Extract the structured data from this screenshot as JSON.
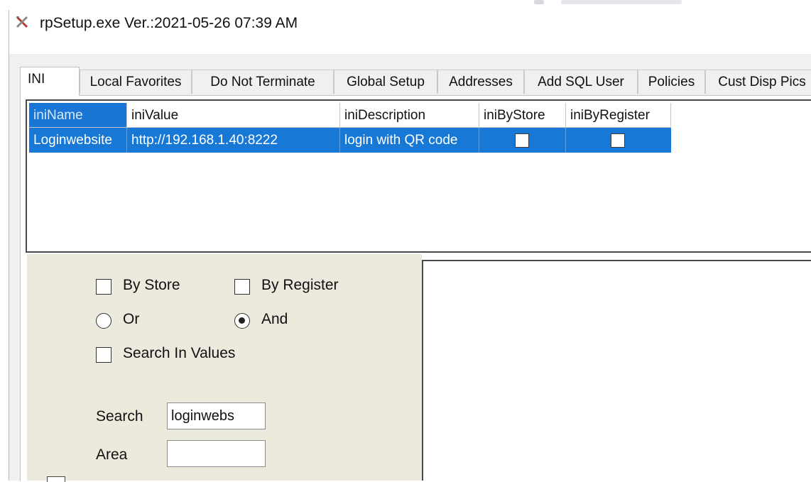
{
  "window": {
    "title": "rpSetup.exe Ver.:2021-05-26 07:39 AM",
    "app_icon": "x-tools-icon"
  },
  "tabs": [
    {
      "label": "INI",
      "active": true
    },
    {
      "label": "Local Favorites",
      "active": false
    },
    {
      "label": "Do Not Terminate",
      "active": false
    },
    {
      "label": "Global Setup",
      "active": false
    },
    {
      "label": "Addresses",
      "active": false
    },
    {
      "label": "Add SQL User",
      "active": false
    },
    {
      "label": "Policies",
      "active": false
    },
    {
      "label": "Cust Disp Pics",
      "active": false
    }
  ],
  "grid": {
    "columns": [
      "iniName",
      "iniValue",
      "iniDescription",
      "iniByStore",
      "iniByRegister"
    ],
    "rows": [
      {
        "iniName": "Loginwebsite",
        "iniValue": "http://192.168.1.40:8222",
        "iniDescription": "login with QR code",
        "iniByStore": false,
        "iniByRegister": false
      }
    ],
    "selection_color": "#1778d6"
  },
  "filters": {
    "by_store": {
      "label": "By Store",
      "checked": false
    },
    "by_register": {
      "label": "By Register",
      "checked": false
    },
    "or": {
      "label": "Or",
      "selected": false
    },
    "and": {
      "label": "And",
      "selected": true
    },
    "search_in_values": {
      "label": "Search In Values",
      "checked": false
    }
  },
  "search": {
    "label": "Search",
    "value": "loginwebs"
  },
  "area": {
    "label": "Area",
    "value": ""
  }
}
